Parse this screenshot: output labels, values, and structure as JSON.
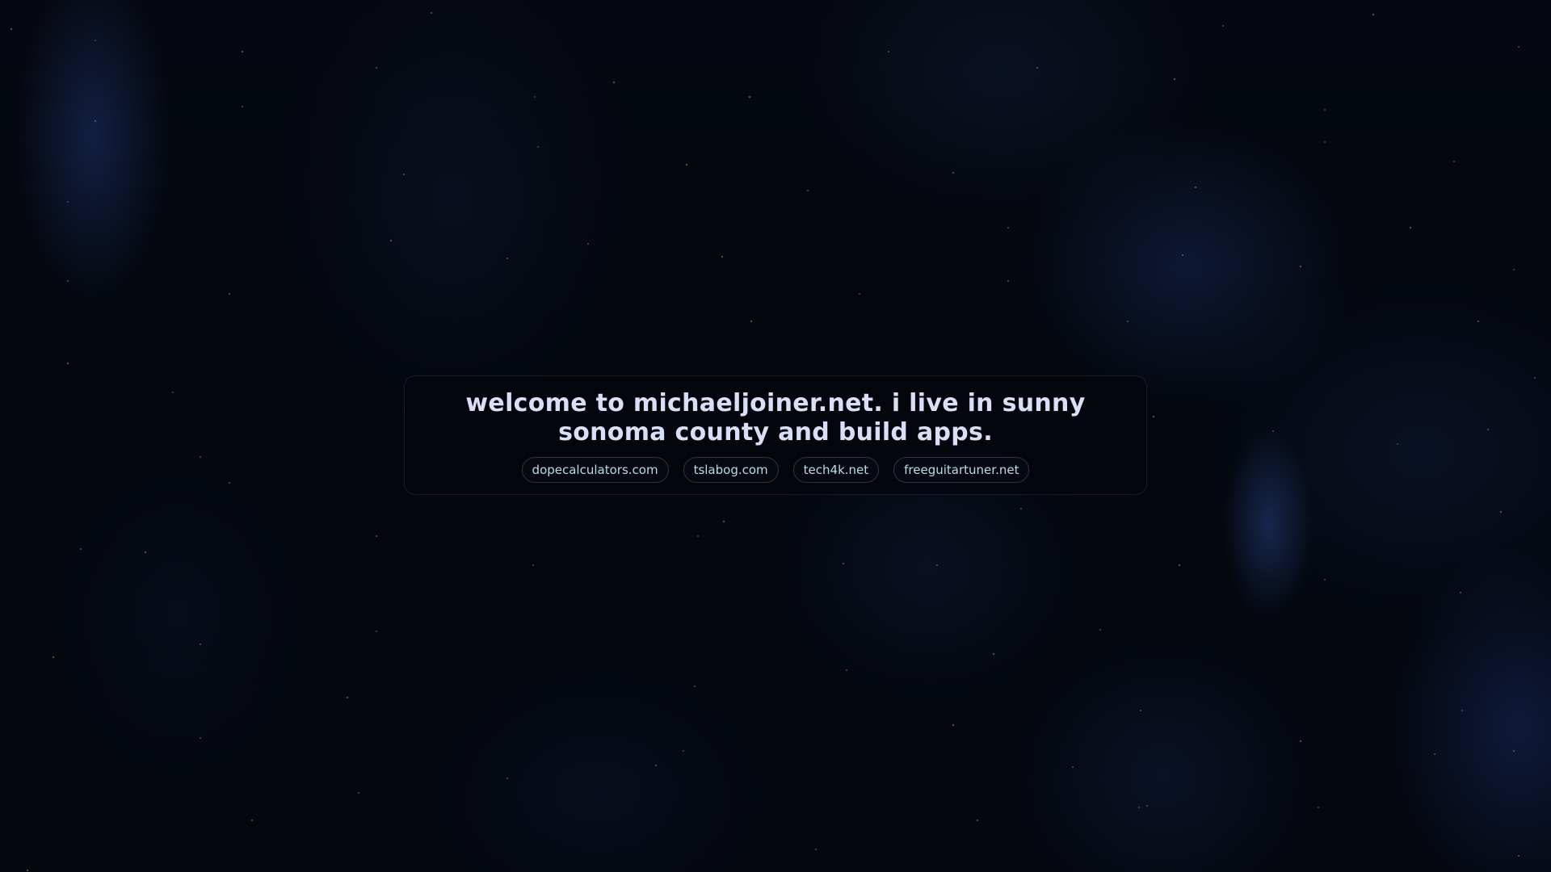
{
  "hero": {
    "headline": "welcome to michaeljoiner.net. i live in sunny sonoma county and build apps."
  },
  "links": [
    {
      "label": "dopecalculators.com"
    },
    {
      "label": "tslabog.com"
    },
    {
      "label": "tech4k.net"
    },
    {
      "label": "freeguitartuner.net"
    }
  ],
  "colors": {
    "background": "#03060c",
    "nebula": "#2a4691",
    "headline": "#d9dff7",
    "link_text": "#bcd9e6"
  }
}
